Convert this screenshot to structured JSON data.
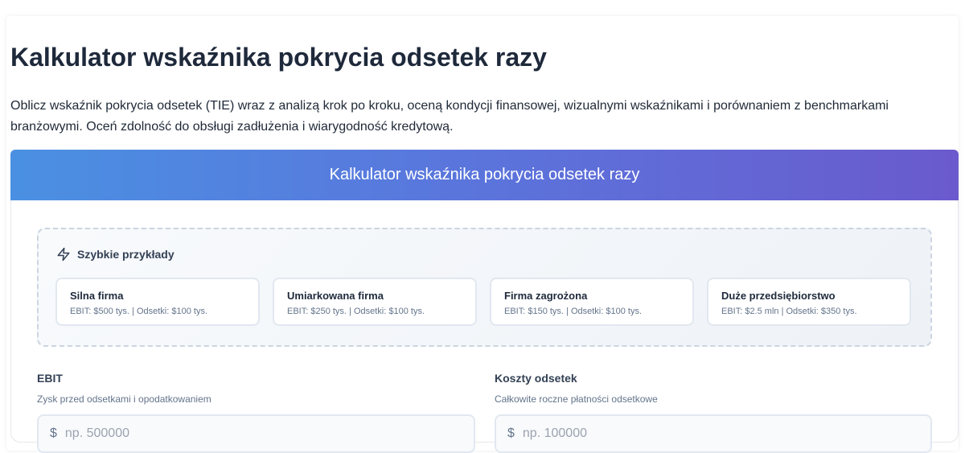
{
  "page": {
    "title": "Kalkulator wskaźnika pokrycia odsetek razy",
    "intro": "Oblicz wskaźnik pokrycia odsetek (TIE) wraz z analizą krok po kroku, oceną kondycji finansowej, wizualnymi wskaźnikami i porównaniem z benchmarkami branżowymi. Oceń zdolność do obsługi zadłużenia i wiarygodność kredytową."
  },
  "calculator": {
    "header": "Kalkulator wskaźnika pokrycia odsetek razy",
    "examples": {
      "title": "Szybkie przykłady",
      "icon": "lightning-icon",
      "items": [
        {
          "name": "Silna firma",
          "desc": "EBIT: $500 tys. | Odsetki: $100 tys."
        },
        {
          "name": "Umiarkowana firma",
          "desc": "EBIT: $250 tys. | Odsetki: $100 tys."
        },
        {
          "name": "Firma zagrożona",
          "desc": "EBIT: $150 tys. | Odsetki: $100 tys."
        },
        {
          "name": "Duże przedsiębiorstwo",
          "desc": "EBIT: $2.5 mln | Odsetki: $350 tys."
        }
      ]
    },
    "fields": {
      "ebit": {
        "label": "EBIT",
        "help": "Zysk przed odsetkami i opodatkowaniem",
        "currency": "$",
        "placeholder": "np. 500000",
        "value": ""
      },
      "interest": {
        "label": "Koszty odsetek",
        "help": "Całkowite roczne płatności odsetkowe",
        "currency": "$",
        "placeholder": "np. 100000",
        "value": ""
      }
    }
  },
  "colors": {
    "header_gradient_start": "#4a90e2",
    "header_gradient_end": "#6a5acd",
    "title": "#1e293b"
  }
}
